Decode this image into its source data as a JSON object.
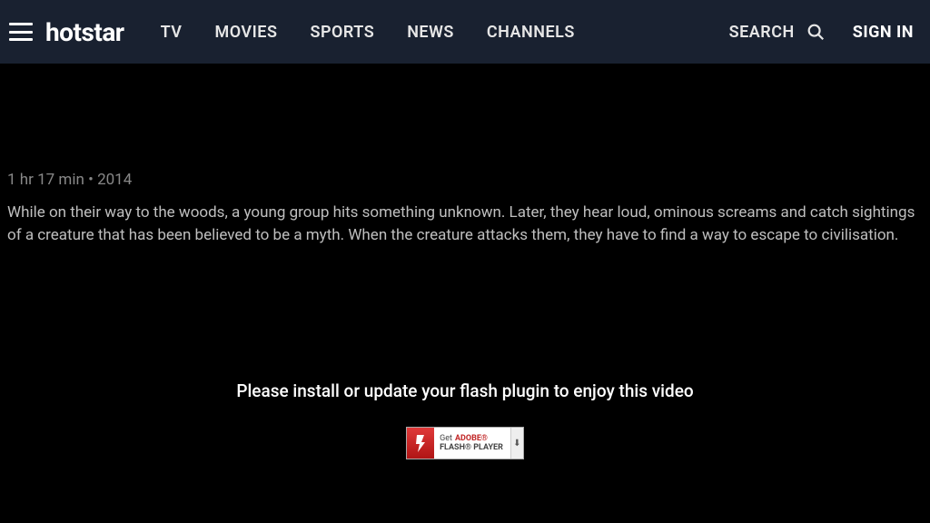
{
  "header": {
    "brand": "hotstar",
    "nav": [
      "TV",
      "MOVIES",
      "SPORTS",
      "NEWS",
      "CHANNELS"
    ],
    "search_label": "SEARCH",
    "signin_label": "SIGN IN"
  },
  "meta": {
    "duration": "1 hr 17 min",
    "separator": "•",
    "year": "2014"
  },
  "description": "While on their way to the woods, a young group hits something unknown. Later, they hear loud, ominous screams and catch sightings of a creature that has been believed to be a myth. When the creature attacks them, they have to find a way to escape to civilisation.",
  "flash": {
    "message": "Please install or update your flash plugin to enjoy this video",
    "badge_get": "Get",
    "badge_brand": "ADOBE®",
    "badge_product": "FLASH® PLAYER",
    "badge_download": "⬇"
  }
}
